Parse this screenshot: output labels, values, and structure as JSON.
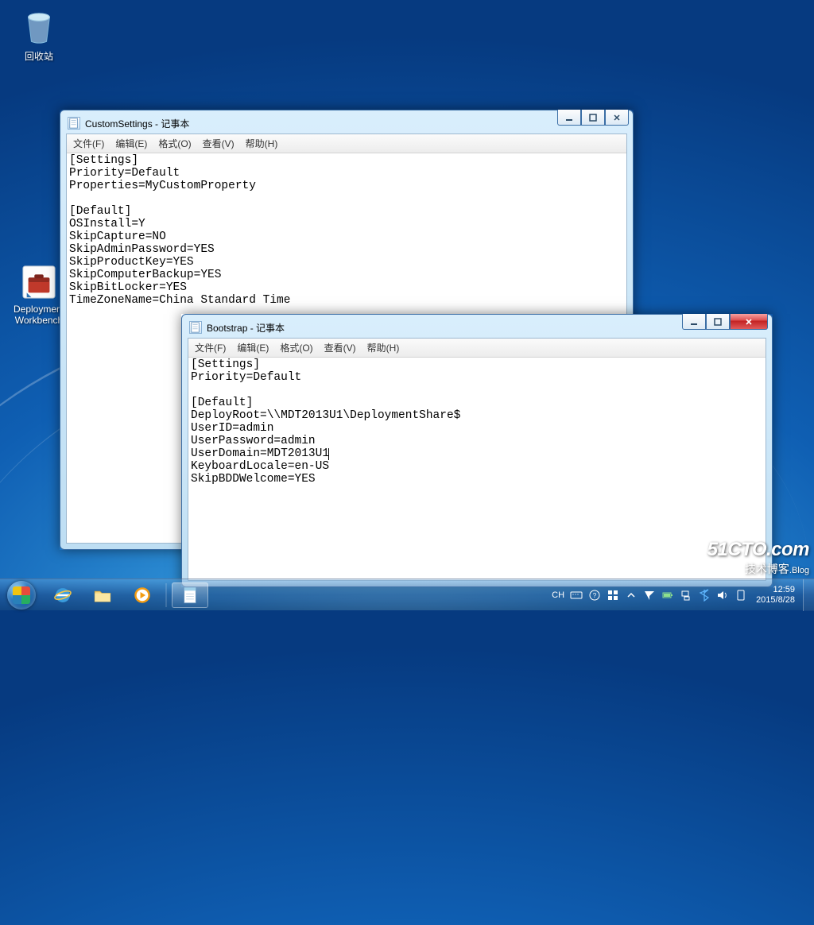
{
  "desktop": {
    "recyclebin_label": "回收站",
    "deploy_label": "Deployment\nWorkbench"
  },
  "windows": {
    "custom": {
      "title": "CustomSettings - 记事本",
      "menus": [
        "文件(F)",
        "编辑(E)",
        "格式(O)",
        "查看(V)",
        "帮助(H)"
      ],
      "content": "[Settings]\nPriority=Default\nProperties=MyCustomProperty\n\n[Default]\nOSInstall=Y\nSkipCapture=NO\nSkipAdminPassword=YES\nSkipProductKey=YES\nSkipComputerBackup=YES\nSkipBitLocker=YES\nTimeZoneName=China Standard Time"
    },
    "bootstrap": {
      "title": "Bootstrap - 记事本",
      "menus": [
        "文件(F)",
        "编辑(E)",
        "格式(O)",
        "查看(V)",
        "帮助(H)"
      ],
      "content_pre": "[Settings]\nPriority=Default\n\n[Default]\nDeployRoot=\\\\MDT2013U1\\DeploymentShare$\nUserID=admin\nUserPassword=admin\nUserDomain=MDT2013U1",
      "content_post": "\nKeyboardLocale=en-US\nSkipBDDWelcome=YES"
    }
  },
  "tray": {
    "ime": "CH",
    "time": "12:59",
    "date": "2015/8/28"
  },
  "watermark": {
    "line1": "51CTO.com",
    "line2": "技术博客",
    "suffix": ".Blog"
  }
}
